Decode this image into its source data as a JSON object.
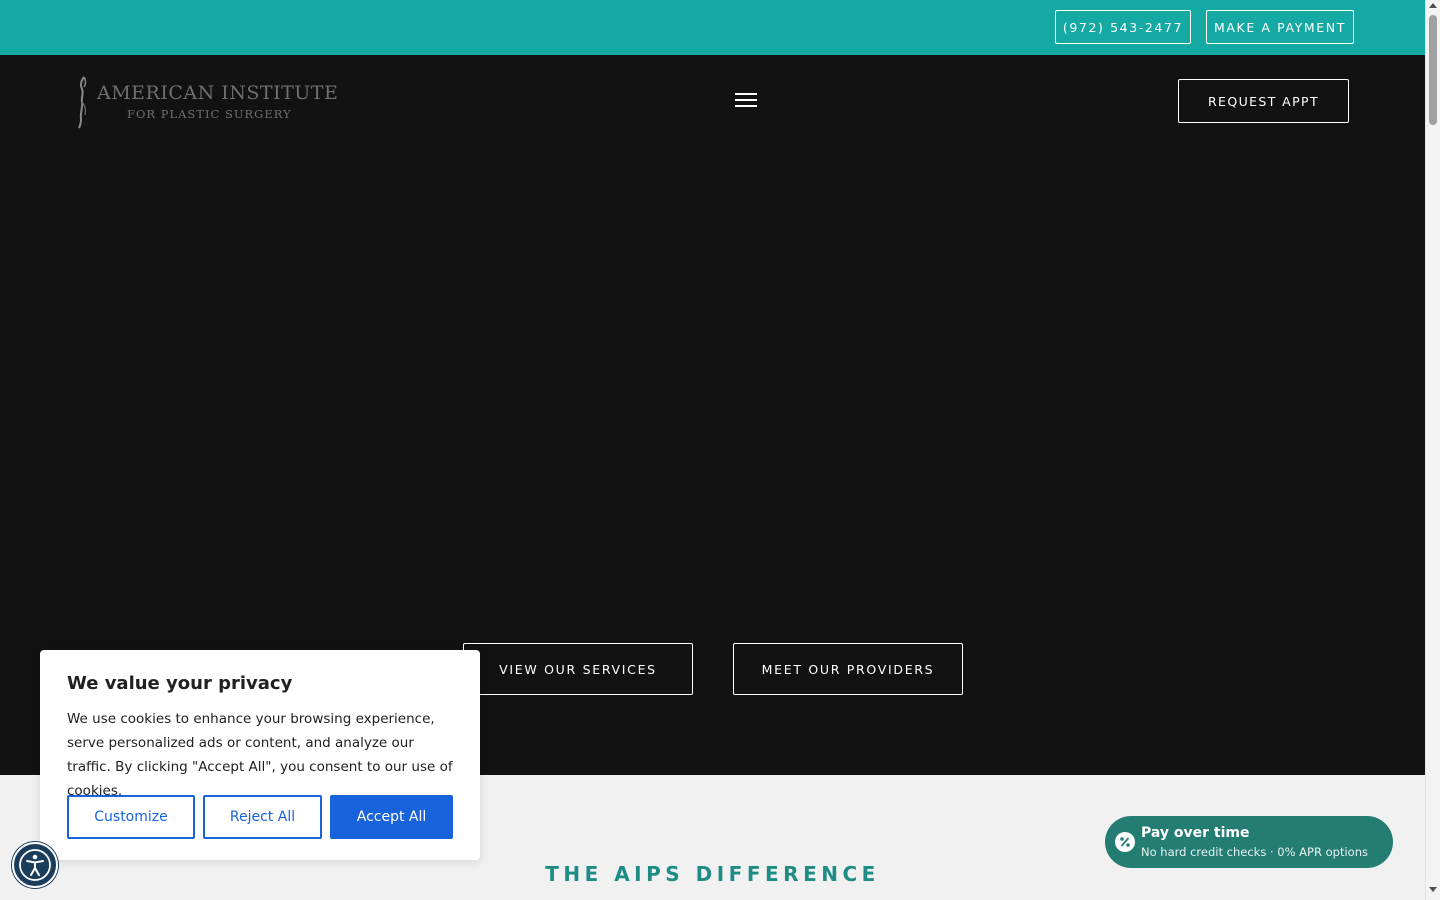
{
  "topbar": {
    "phone_label": "(972) 543-2477",
    "payment_label": "MAKE A PAYMENT",
    "bg_color": "#14aaa3"
  },
  "header": {
    "logo_line1": "AMERICAN INSTITUTE",
    "logo_line2": "FOR PLASTIC SURGERY",
    "menu_icon": "hamburger-menu-icon",
    "request_label": "REQUEST APPT"
  },
  "hero": {
    "services_label": "VIEW OUR SERVICES",
    "providers_label": "MEET OUR PROVIDERS",
    "bg_color": "#121212"
  },
  "section": {
    "title": "THE AIPS DIFFERENCE",
    "title_color": "#1d8c84"
  },
  "cookie_banner": {
    "title": "We value your privacy",
    "text": "We use cookies to enhance your browsing experience, serve personalized ads or content, and analyze our traffic. By clicking \"Accept All\", you consent to our use of cookies.",
    "customize_label": "Customize",
    "reject_label": "Reject All",
    "accept_label": "Accept All",
    "accent_color": "#1863dc"
  },
  "accessibility": {
    "icon": "accessibility-icon"
  },
  "financing_widget": {
    "title": "Pay over time",
    "subtitle": "No hard credit checks · 0% APR options",
    "icon": "percent-icon",
    "bg_color": "#247d72"
  }
}
